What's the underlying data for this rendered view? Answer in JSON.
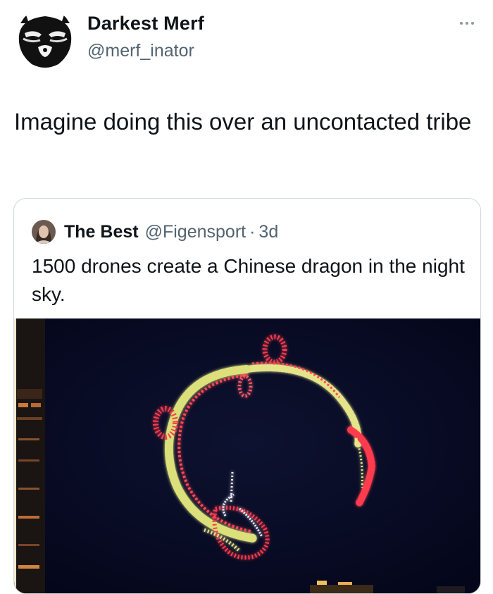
{
  "tweet": {
    "display_name": "Darkest Merf",
    "handle": "@merf_inator",
    "text": "Imagine doing this over an uncontacted tribe",
    "avatar_icon": "masked-face-avatar",
    "more_icon": "more-dots-icon"
  },
  "quoted_tweet": {
    "display_name": "The Best",
    "handle": "@Figensport",
    "separator": "·",
    "time": "3d",
    "text": "1500 drones create a Chinese dragon in the night sky.",
    "media": "drone-dragon-night-sky-photo"
  },
  "colors": {
    "text_primary": "#0f1419",
    "text_secondary": "#536471",
    "border": "#cfd9de",
    "night_sky": "#070a1d",
    "drone_red": "#ff3b4e",
    "drone_gold": "#e9e98a"
  }
}
